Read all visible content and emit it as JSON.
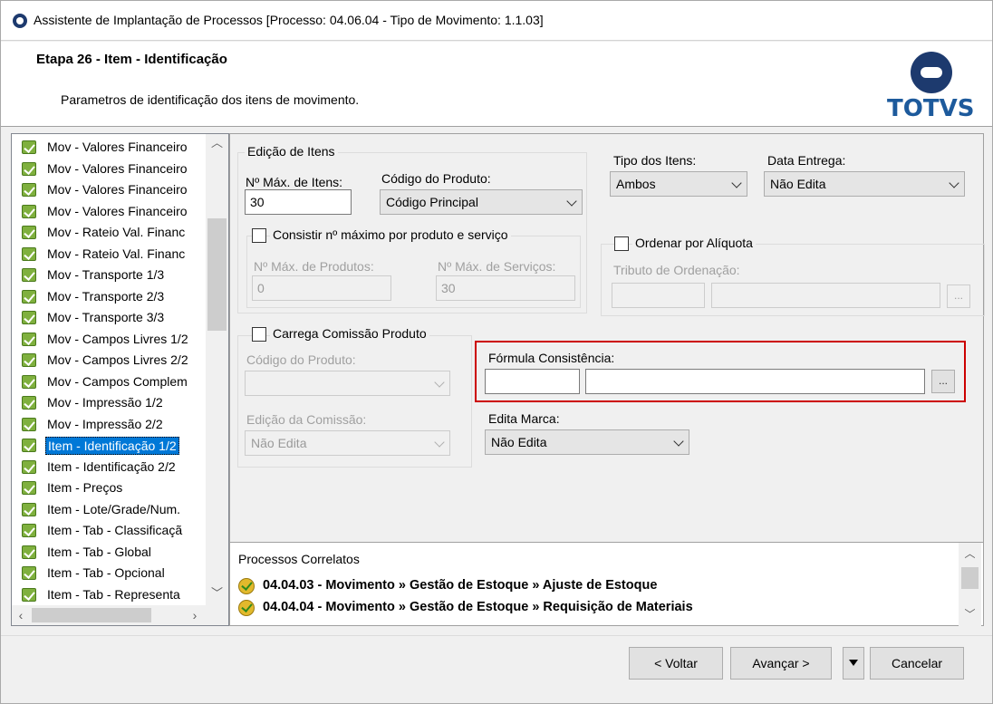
{
  "window": {
    "title": "Assistente de Implantação de Processos [Processo: 04.06.04 - Tipo de Movimento: 1.1.03]"
  },
  "header": {
    "step_title": "Etapa 26 - Item - Identificação",
    "step_description": "Parametros de identificação dos itens de movimento.",
    "logo_text": "TOTVS",
    "logo_color": "#1d3a6e"
  },
  "steps": {
    "items": [
      {
        "label": "Mov - Valores Financeiro"
      },
      {
        "label": "Mov - Valores Financeiro"
      },
      {
        "label": "Mov - Valores Financeiro"
      },
      {
        "label": "Mov - Valores Financeiro"
      },
      {
        "label": "Mov - Rateio Val. Financ"
      },
      {
        "label": "Mov - Rateio Val. Financ"
      },
      {
        "label": "Mov - Transporte 1/3"
      },
      {
        "label": "Mov - Transporte 2/3"
      },
      {
        "label": "Mov - Transporte 3/3"
      },
      {
        "label": "Mov - Campos Livres 1/2"
      },
      {
        "label": "Mov - Campos Livres 2/2"
      },
      {
        "label": "Mov - Campos Complem"
      },
      {
        "label": "Mov - Impressão 1/2"
      },
      {
        "label": "Mov - Impressão 2/2"
      },
      {
        "label": "Item - Identificação 1/2"
      },
      {
        "label": "Item - Identificação 2/2"
      },
      {
        "label": "Item - Preços"
      },
      {
        "label": "Item - Lote/Grade/Num."
      },
      {
        "label": "Item - Tab - Classificaçã"
      },
      {
        "label": "Item - Tab - Global"
      },
      {
        "label": "Item - Tab - Opcional"
      },
      {
        "label": "Item - Tab - Representa"
      }
    ],
    "selected_index": 14,
    "selected_color": "#0078d7"
  },
  "edicao_itens": {
    "group_title": "Edição de Itens",
    "max_itens_label": "Nº Máx. de Itens:",
    "max_itens_value": "30",
    "codigo_produto_label": "Código do Produto:",
    "codigo_produto_value": "Código Principal",
    "consistir_label": "Consistir nº máximo por produto e serviço",
    "max_produtos_label": "Nº Máx. de Produtos:",
    "max_produtos_value": "0",
    "max_servicos_label": "Nº Máx. de Serviços:",
    "max_servicos_value": "30"
  },
  "tipo_itens": {
    "label": "Tipo dos Itens:",
    "value": "Ambos"
  },
  "data_entrega": {
    "label": "Data Entrega:",
    "value": "Não Edita"
  },
  "ordenar": {
    "group_title": "Ordenar por Alíquota",
    "tributo_label": "Tributo de Ordenação:",
    "ellipsis": "..."
  },
  "comissao": {
    "group_title": "Carrega Comissão Produto",
    "codigo_produto_label": "Código do Produto:",
    "edicao_label": "Edição da Comissão:",
    "edicao_value": "Não Edita"
  },
  "formula": {
    "label": "Fórmula Consistência:",
    "ellipsis": "...",
    "highlight_color": "#cc0000"
  },
  "edita_marca": {
    "label": "Edita Marca:",
    "value": "Não Edita"
  },
  "correlatos": {
    "title": "Processos Correlatos",
    "items": [
      {
        "text": "04.04.03 - Movimento » Gestão de Estoque » Ajuste de Estoque"
      },
      {
        "text": "04.04.04 - Movimento » Gestão de Estoque » Requisição de Materiais"
      }
    ]
  },
  "buttons": {
    "voltar": "< Voltar",
    "avancar": "Avançar >",
    "cancelar": "Cancelar"
  }
}
